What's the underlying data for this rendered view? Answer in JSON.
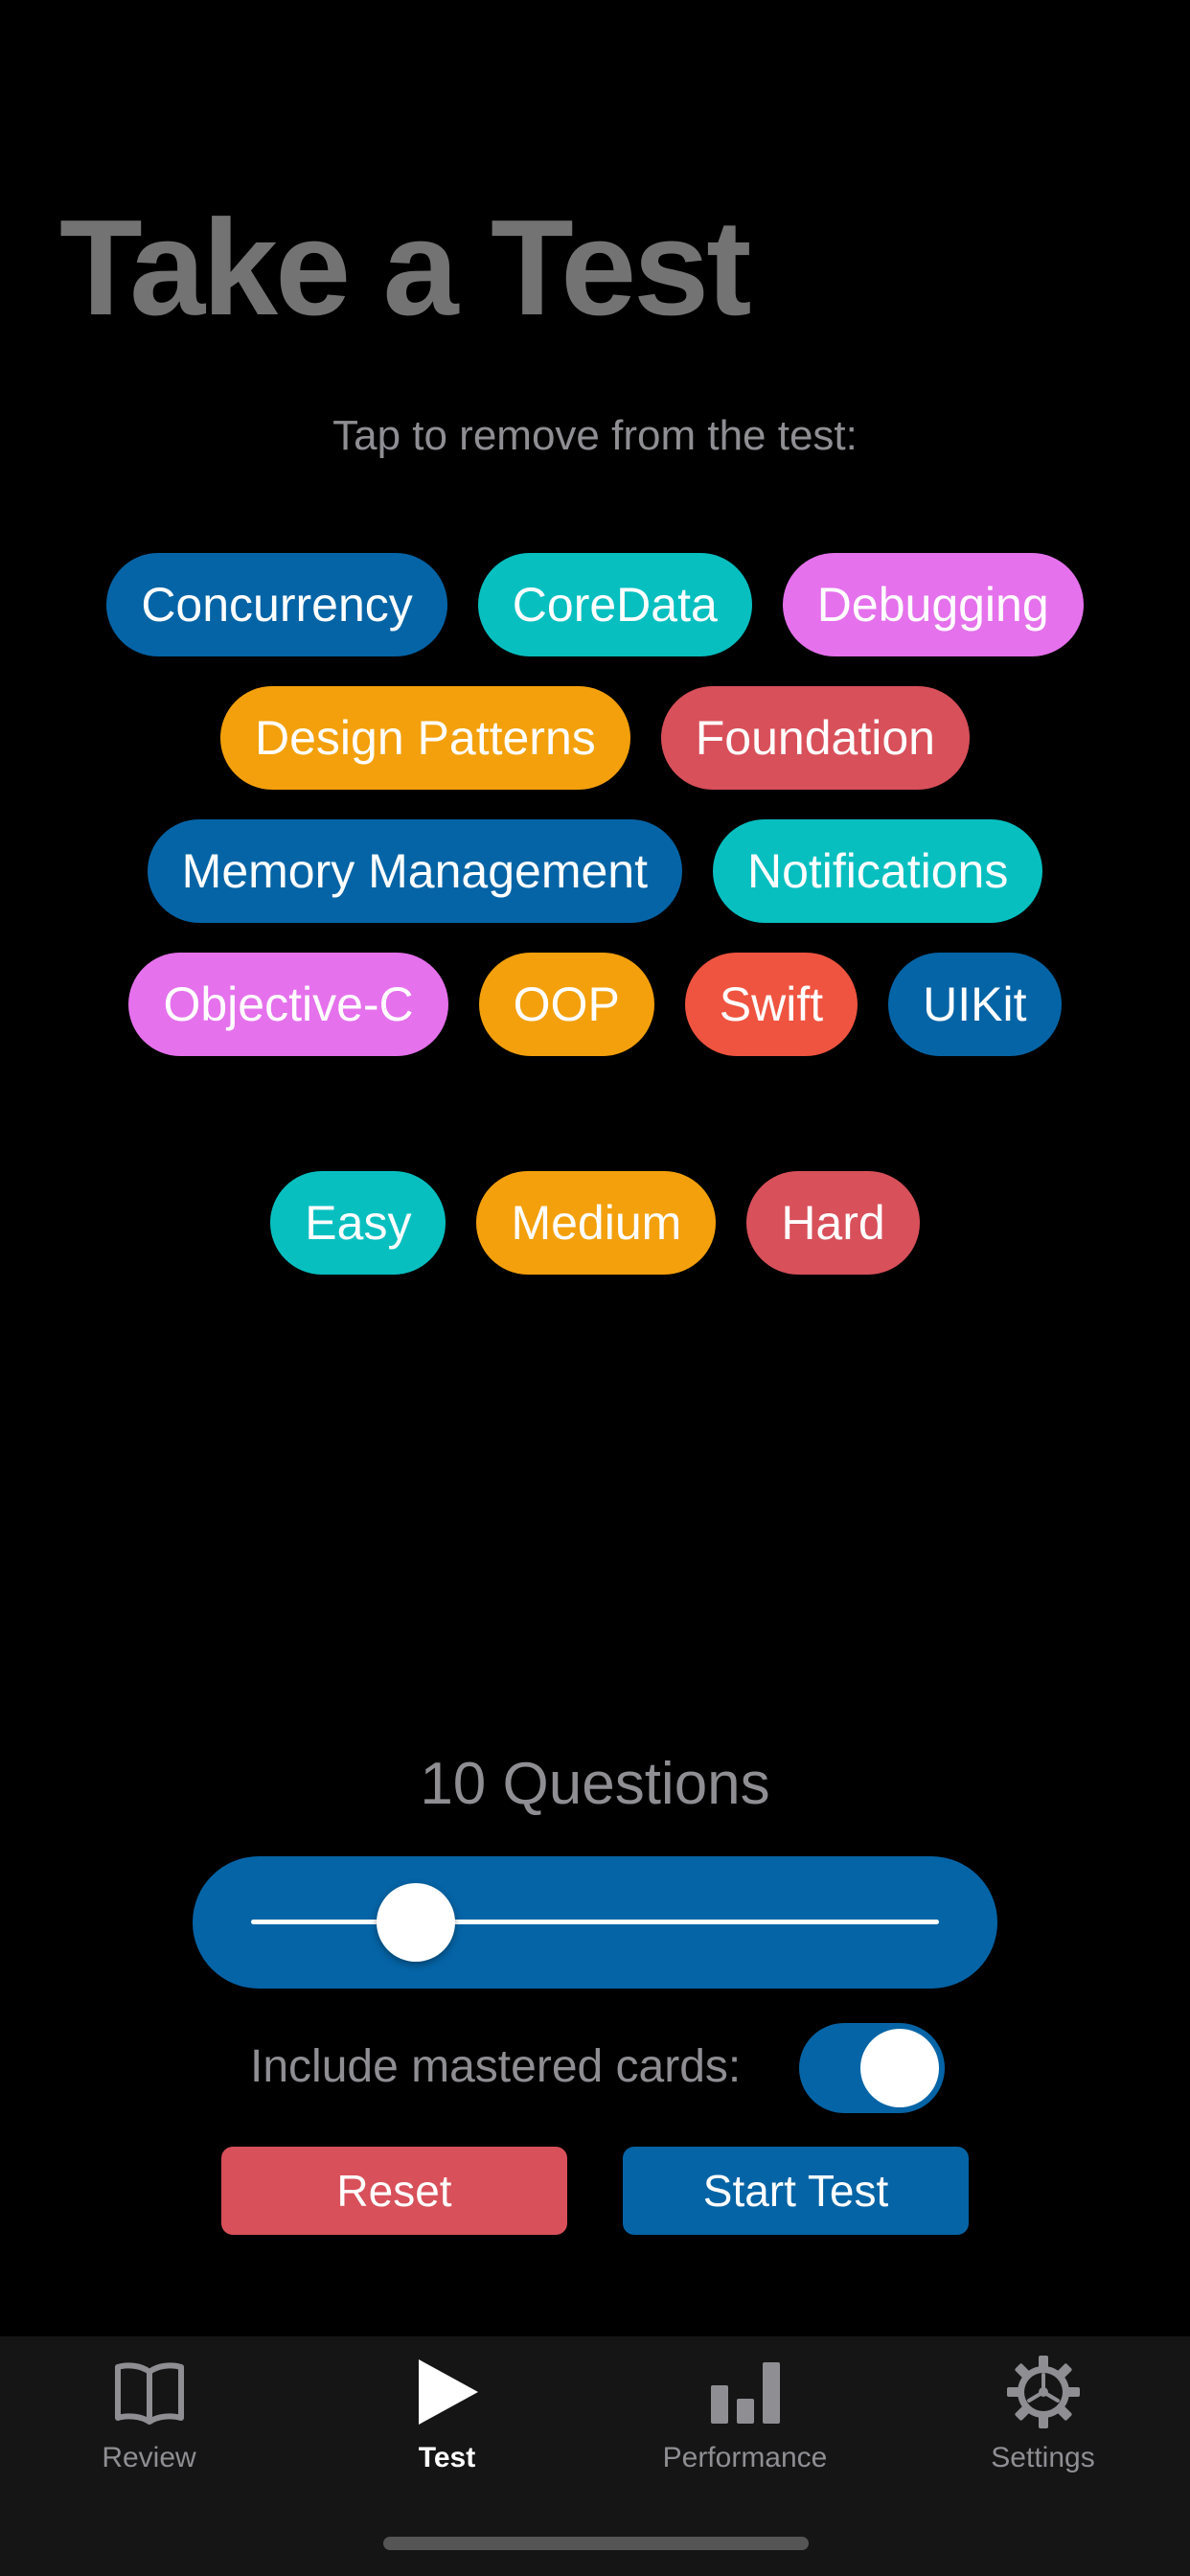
{
  "header": {
    "title": "Take a Test",
    "subtitle": "Tap to remove from the test:"
  },
  "categories": [
    {
      "label": "Concurrency",
      "color": "#0564a6"
    },
    {
      "label": "CoreData",
      "color": "#08bfc0"
    },
    {
      "label": "Debugging",
      "color": "#e571ec"
    },
    {
      "label": "Design Patterns",
      "color": "#f3a00c"
    },
    {
      "label": "Foundation",
      "color": "#d8505a"
    },
    {
      "label": "Memory Management",
      "color": "#0564a6"
    },
    {
      "label": "Notifications",
      "color": "#08bfc0"
    },
    {
      "label": "Objective-C",
      "color": "#e571ec"
    },
    {
      "label": "OOP",
      "color": "#f3a00c"
    },
    {
      "label": "Swift",
      "color": "#ef5440"
    },
    {
      "label": "UIKit",
      "color": "#0564a6"
    }
  ],
  "difficulties": [
    {
      "label": "Easy",
      "color": "#08bfc0"
    },
    {
      "label": "Medium",
      "color": "#f3a00c"
    },
    {
      "label": "Hard",
      "color": "#d8505a"
    }
  ],
  "questions": {
    "count_label": "10 Questions",
    "slider_fraction": 0.24
  },
  "mastered": {
    "label": "Include mastered cards:",
    "enabled": true
  },
  "actions": {
    "reset_label": "Reset",
    "start_label": "Start Test"
  },
  "tab_bar": {
    "items": [
      {
        "label": "Review",
        "icon": "book-icon",
        "active": false
      },
      {
        "label": "Test",
        "icon": "play-icon",
        "active": true
      },
      {
        "label": "Performance",
        "icon": "bar-chart-icon",
        "active": false
      },
      {
        "label": "Settings",
        "icon": "gear-icon",
        "active": false
      }
    ]
  },
  "colors": {
    "background": "#000000",
    "accent_blue": "#0564a6",
    "reset_red": "#d8505a",
    "muted_text": "#8e8e93"
  }
}
